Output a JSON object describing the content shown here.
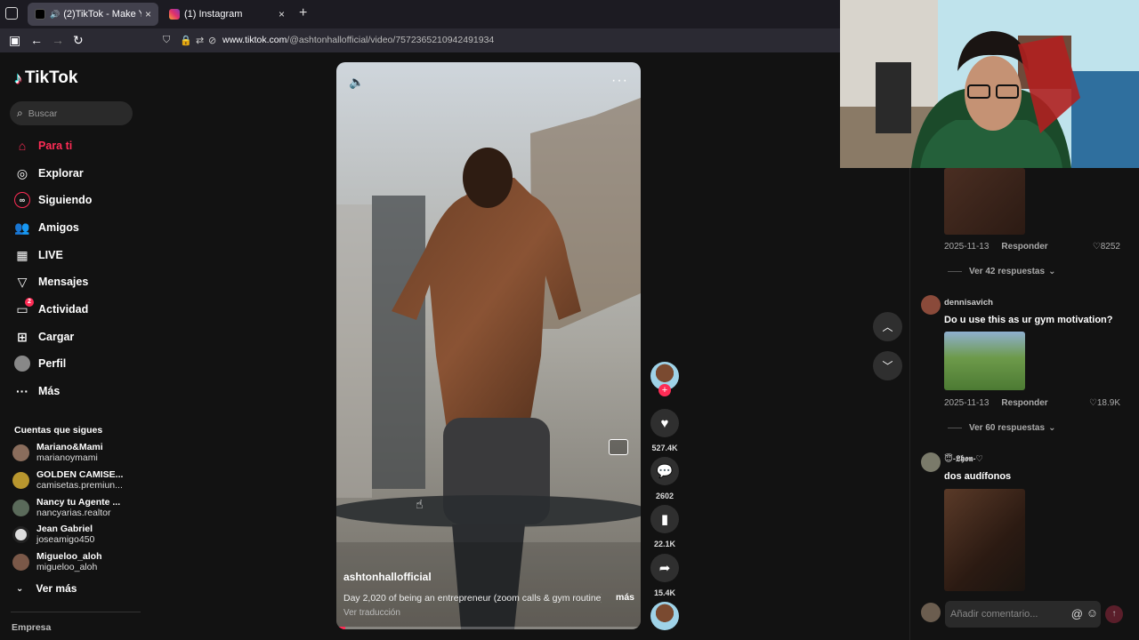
{
  "browser": {
    "tabs": [
      {
        "title": "(2)TikTok - Make Your Day",
        "active": true
      },
      {
        "title": "(1) Instagram",
        "active": false
      }
    ],
    "new_tab": "+",
    "close": "×",
    "url_domain": "www.tiktok.com",
    "url_path": "/@ashtonhallofficial/video/7572365210942491934"
  },
  "sidebar": {
    "logo": "TikTok",
    "search_placeholder": "Buscar",
    "nav": [
      {
        "label": "Para ti",
        "icon": "home-icon",
        "active": true
      },
      {
        "label": "Explorar",
        "icon": "compass-icon"
      },
      {
        "label": "Siguiendo",
        "icon": "following-icon"
      },
      {
        "label": "Amigos",
        "icon": "friends-icon"
      },
      {
        "label": "LIVE",
        "icon": "live-icon"
      },
      {
        "label": "Mensajes",
        "icon": "messages-icon"
      },
      {
        "label": "Actividad",
        "icon": "activity-icon",
        "badge": "2"
      },
      {
        "label": "Cargar",
        "icon": "upload-icon"
      },
      {
        "label": "Perfil",
        "icon": "profile-icon"
      },
      {
        "label": "Más",
        "icon": "more-dots-icon"
      }
    ],
    "following_title": "Cuentas que sigues",
    "following": [
      {
        "name": "Mariano&Mami",
        "handle": "marianoymami"
      },
      {
        "name": "GOLDEN CAMISE...",
        "handle": "camisetas.premiun..."
      },
      {
        "name": "Nancy tu Agente ...",
        "handle": "nancyarias.realtor"
      },
      {
        "name": "Jean Gabriel",
        "handle": "joseamigo450"
      },
      {
        "name": "Migueloo_aloh",
        "handle": "migueloo_aloh"
      }
    ],
    "see_more": "Ver más",
    "footer": "Empresa"
  },
  "video": {
    "username": "ashtonhallofficial",
    "description": "Day 2,020 of being an entrepreneur (zoom calls & gym routine) ...",
    "more": "más",
    "translate": "Ver traducción",
    "progress": 0.03
  },
  "actions": {
    "likes": "527.4K",
    "comments": "2602",
    "saves": "22.1K",
    "shares": "15.4K"
  },
  "comments": {
    "items": [
      {
        "date": "2025-11-13",
        "reply": "Responder",
        "likes": "8252",
        "replies": "Ver 42 respuestas"
      },
      {
        "user": "dennisavich",
        "text": "Do u use this as ur gym motivation?",
        "date": "2025-11-13",
        "reply": "Responder",
        "likes": "18.9K",
        "replies": "Ver 60 respuestas"
      },
      {
        "user": "😇-𝕷𝖍𝖔𝖓-♡",
        "text": "dos audífonos"
      }
    ],
    "input_placeholder": "Añadir comentario..."
  },
  "colors": {
    "accent": "#fe2c55",
    "bg": "#121212"
  }
}
